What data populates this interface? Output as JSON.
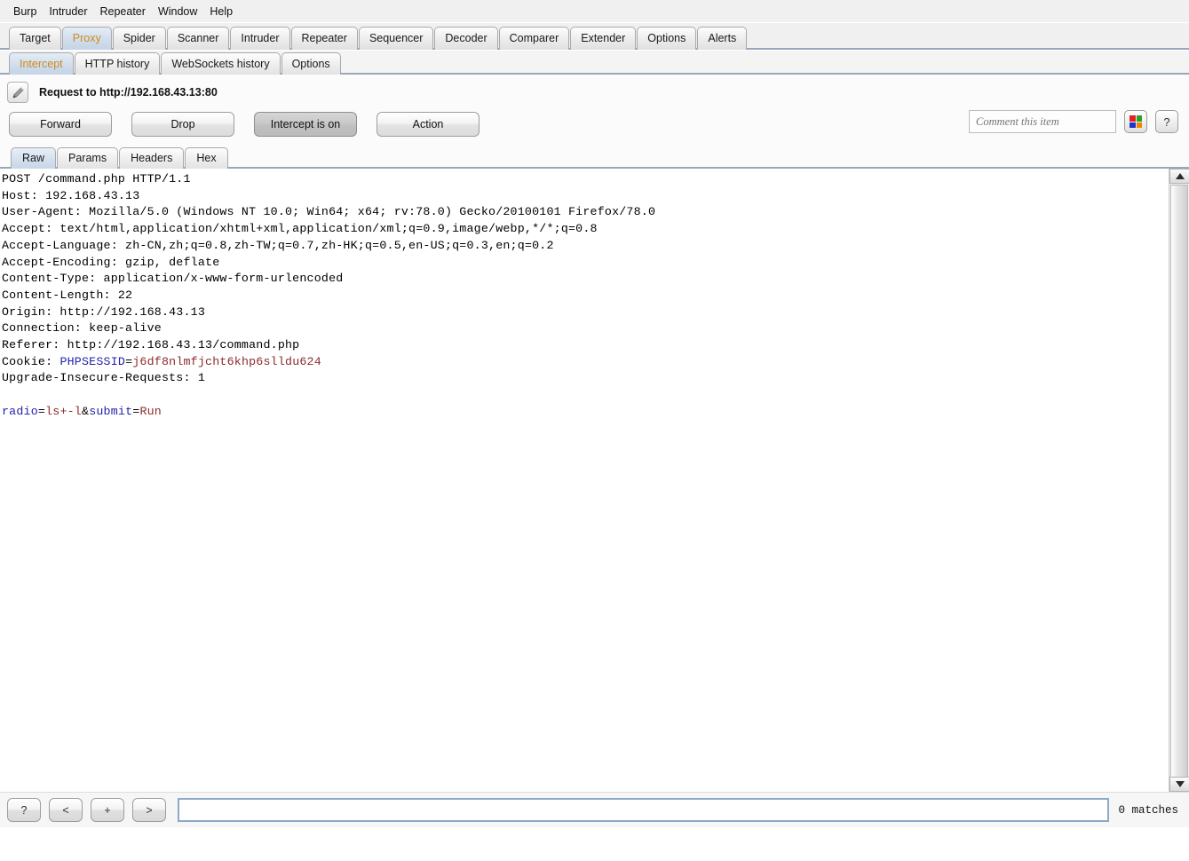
{
  "menubar": {
    "items": [
      "Burp",
      "Intruder",
      "Repeater",
      "Window",
      "Help"
    ]
  },
  "main_tabs": {
    "selected": "Proxy",
    "items": [
      "Target",
      "Proxy",
      "Spider",
      "Scanner",
      "Intruder",
      "Repeater",
      "Sequencer",
      "Decoder",
      "Comparer",
      "Extender",
      "Options",
      "Alerts"
    ]
  },
  "proxy_tabs": {
    "selected": "Intercept",
    "items": [
      "Intercept",
      "HTTP history",
      "WebSockets history",
      "Options"
    ]
  },
  "intercept": {
    "edit_icon": "pencil-icon",
    "request_label": "Request to http://192.168.43.13:80",
    "buttons": {
      "forward": "Forward",
      "drop": "Drop",
      "intercept_toggle": "Intercept is on",
      "action": "Action"
    },
    "comment_placeholder": "Comment this item",
    "highlight_icon": "color-swatch-icon",
    "help_icon": "?",
    "swatch_colors": [
      "#dd2222",
      "#2aa02a",
      "#2233cc",
      "#ee8800"
    ]
  },
  "message_tabs": {
    "selected": "Raw",
    "items": [
      "Raw",
      "Params",
      "Headers",
      "Hex"
    ]
  },
  "request": {
    "lines": [
      {
        "text": "POST /command.php HTTP/1.1"
      },
      {
        "text": "Host: 192.168.43.13"
      },
      {
        "text": "User-Agent: Mozilla/5.0 (Windows NT 10.0; Win64; x64; rv:78.0) Gecko/20100101 Firefox/78.0"
      },
      {
        "text": "Accept: text/html,application/xhtml+xml,application/xml;q=0.9,image/webp,*/*;q=0.8"
      },
      {
        "text": "Accept-Language: zh-CN,zh;q=0.8,zh-TW;q=0.7,zh-HK;q=0.5,en-US;q=0.3,en;q=0.2"
      },
      {
        "text": "Accept-Encoding: gzip, deflate"
      },
      {
        "text": "Content-Type: application/x-www-form-urlencoded"
      },
      {
        "text": "Content-Length: 22"
      },
      {
        "text": "Origin: http://192.168.43.13"
      },
      {
        "text": "Connection: keep-alive"
      },
      {
        "text": "Referer: http://192.168.43.13/command.php"
      },
      {
        "prefix": "Cookie: ",
        "name": "PHPSESSID",
        "eq": "=",
        "value": "j6df8nlmfjcht6khp6slldu624"
      },
      {
        "text": "Upgrade-Insecure-Requests: 1"
      },
      {
        "text": ""
      },
      {
        "body": [
          {
            "name": "radio",
            "eq": "=",
            "value": "ls+-l"
          },
          {
            "sep": "&"
          },
          {
            "name": "submit",
            "eq": "=",
            "value": "Run"
          }
        ]
      }
    ]
  },
  "searchbar": {
    "help_button": "?",
    "prev_button": "<",
    "add_button": "+",
    "next_button": ">",
    "query": "",
    "matches": "0 matches"
  }
}
